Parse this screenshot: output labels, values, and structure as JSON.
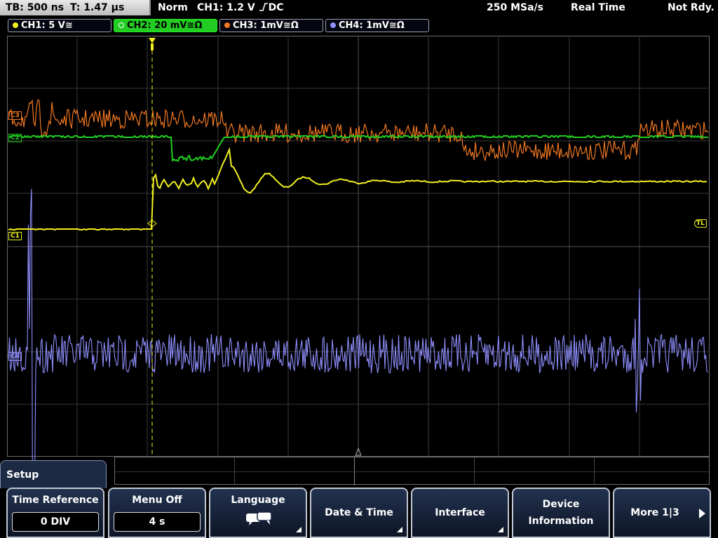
{
  "status": {
    "timebase": "TB: 500 ns",
    "trigger_time": "T: 1.47 µs",
    "trigger_mode": "Norm",
    "trigger_source": "CH1: 1.2 V",
    "trigger_coupling": "DC",
    "sample_rate": "250 MSa/s",
    "acq_mode": "Real Time",
    "run_state": "Not Rdy."
  },
  "channels": [
    {
      "label": "CH1: 5 V",
      "color": "#f0f020",
      "coupling": "≅"
    },
    {
      "label": "CH2: 20 mV",
      "color": "#20d020",
      "coupling": "≅Ω"
    },
    {
      "label": "CH3: 1mV",
      "color": "#f07820",
      "coupling": "≅Ω"
    },
    {
      "label": "CH4: 1mV",
      "color": "#9090ff",
      "coupling": "≅Ω"
    }
  ],
  "markers": {
    "ch3": "C3",
    "ch2": "C2",
    "ch1": "C1",
    "ch4": "C4",
    "trigger_level": "TL"
  },
  "menu": {
    "title": "Setup",
    "softkeys": [
      {
        "label": "Time Reference",
        "value": "0 DIV"
      },
      {
        "label": "Menu Off",
        "value": "4 s"
      },
      {
        "label": "Language",
        "icon": "speech-bubble-icon"
      },
      {
        "label": "Date & Time"
      },
      {
        "label": "Interface"
      },
      {
        "label": "Device",
        "label2": "Information"
      },
      {
        "label": "More 1|3"
      }
    ]
  }
}
